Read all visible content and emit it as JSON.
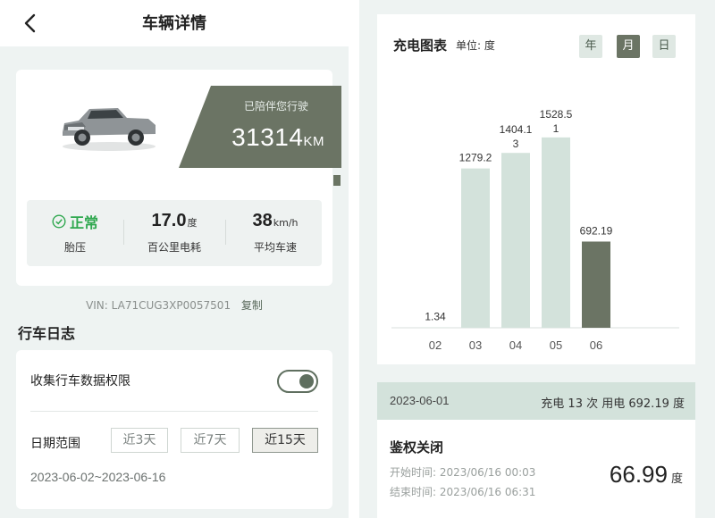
{
  "detail": {
    "title": "车辆详情",
    "mileage": {
      "label": "已陪伴您行驶",
      "value": "31314",
      "unit": "KM"
    },
    "stats": {
      "tire": {
        "status": "正常",
        "label": "胎压"
      },
      "consumption": {
        "value": "17.0",
        "unit": "度",
        "label": "百公里电耗"
      },
      "speed": {
        "value": "38",
        "unit": "km/h",
        "label": "平均车速"
      }
    },
    "vin": "VIN: LA71CUG3XP0057501",
    "copy_label": "复制"
  },
  "log": {
    "title": "行车日志",
    "permission_label": "收集行车数据权限",
    "permission_on": true,
    "range_label": "日期范围",
    "range_options": [
      "近3天",
      "近7天",
      "近15天"
    ],
    "range_selected": "近15天",
    "date_range": "2023-06-02~2023-06-16"
  },
  "chart": {
    "title": "充电图表",
    "unit_label": "单位: 度",
    "periods": [
      "年",
      "月",
      "日"
    ],
    "period_selected": "月"
  },
  "chart_data": {
    "type": "bar",
    "categories": [
      "02",
      "03",
      "04",
      "05",
      "06"
    ],
    "values": [
      1.34,
      1279.2,
      1404.13,
      1528.51,
      692.19
    ],
    "value_labels_line1": [
      "1.34",
      "1279.2",
      "1404.1",
      "1528.5",
      "692.19"
    ],
    "value_labels_line2": [
      "",
      "",
      "3",
      "1",
      ""
    ],
    "highlighted_category": "06",
    "ylim": [
      0,
      1800
    ],
    "colors": {
      "normal": "#d3e2db",
      "highlight": "#6b7464"
    },
    "grid": false,
    "title": "充电图表",
    "ylabel": "单位: 度"
  },
  "summary": {
    "date": "2023-06-01",
    "text": "充电 13 次 用电 692.19 度"
  },
  "session": {
    "title": "鉴权关闭",
    "start": "开始时间: 2023/06/16 00:03",
    "end": "结束时间: 2023/06/16 06:31",
    "value": "66.99",
    "unit": "度"
  },
  "colors": {
    "accent": "#6b7464",
    "light_accent": "#d3e2db",
    "ok_green": "#2fa84f",
    "background": "#eef3f2"
  },
  "icons": [
    "back-arrow-icon",
    "car-image",
    "check-circle-icon"
  ]
}
